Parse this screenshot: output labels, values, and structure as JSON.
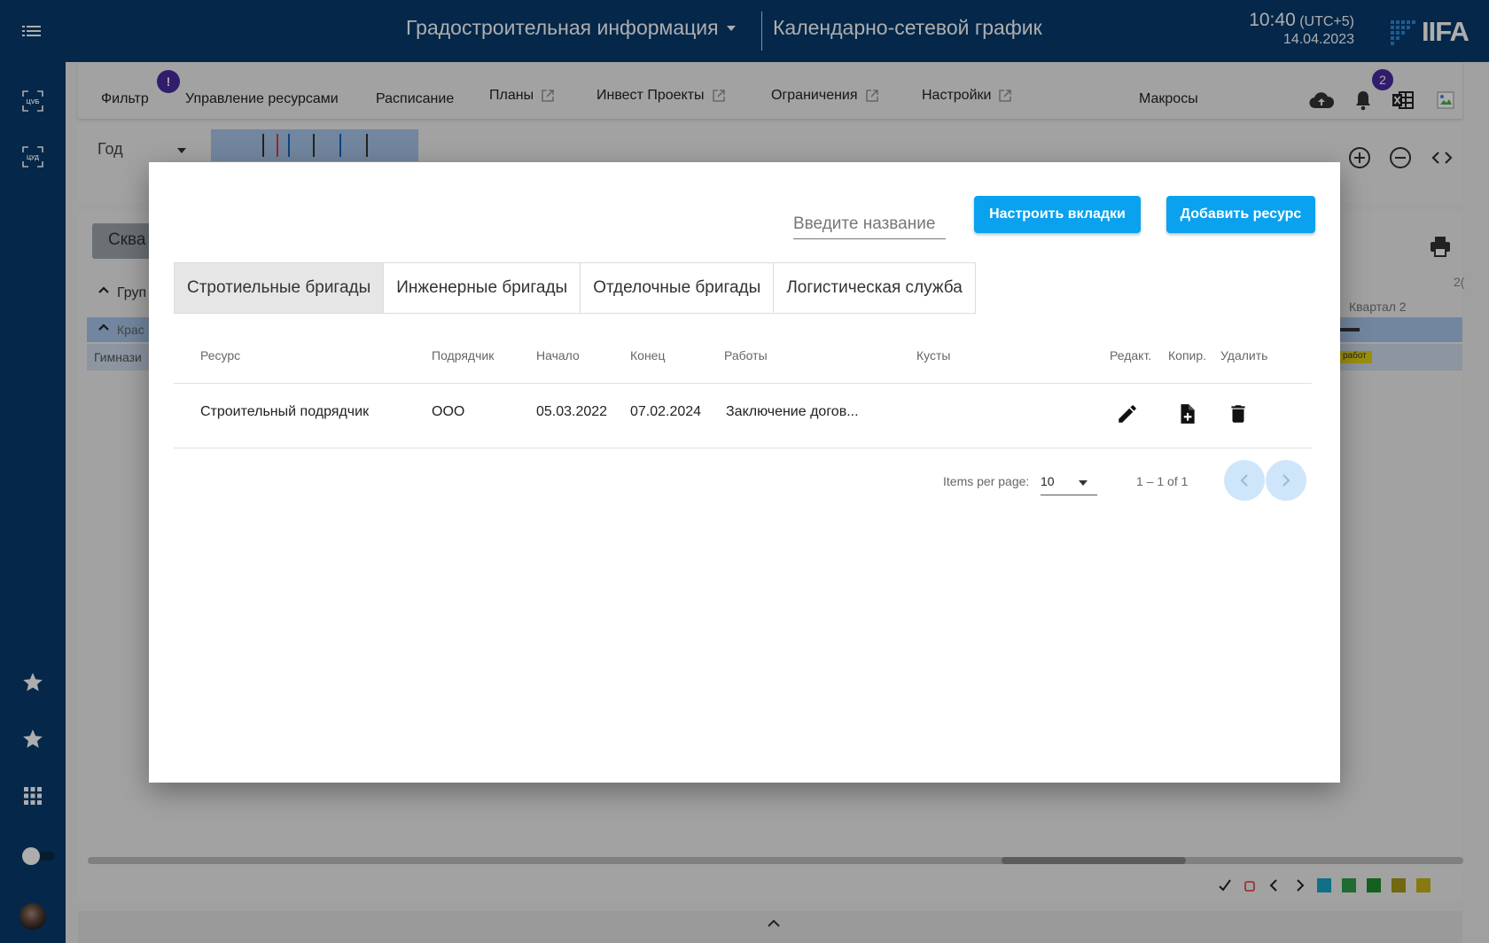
{
  "header": {
    "module_title": "Градостроительная информация",
    "page_title": "Календарно-сетевой график",
    "time": "10:40",
    "timezone": "(UTC+5)",
    "date": "14.04.2023",
    "logo_text": "IIFA"
  },
  "left_nav": {
    "items": [
      "menu-icon",
      "cvb-icon",
      "cud-icon",
      "star-icon",
      "star-icon",
      "grid-icon",
      "toggle",
      "avatar"
    ]
  },
  "toolbar": {
    "filter": "Фильтр",
    "filter_badge": "!",
    "resources": "Управление ресурсами",
    "schedule": "Расписание",
    "plans": "Планы",
    "invest": "Инвест Проекты",
    "limits": "Ограничения",
    "settings": "Настройки",
    "macros": "Макросы",
    "notif_count": "2"
  },
  "scale": {
    "label": "Год"
  },
  "background": {
    "grey_button": "Сква",
    "group_label": "Груп",
    "row1": "Крас",
    "row2": "Гимнази",
    "quarter": "Квартал 2",
    "year_partial": "2(",
    "works_chip": "работ"
  },
  "modal": {
    "search_placeholder": "Введите название",
    "configure_tabs": "Настроить вкладки",
    "add_resource": "Добавить ресурс",
    "tabs": [
      "Стротиельные бригады",
      "Инженерные бригады",
      "Отделочные бригады",
      "Логистическая служба"
    ],
    "active_tab": 0,
    "columns": {
      "resource": "Ресурс",
      "contractor": "Подрядчик",
      "start": "Начало",
      "end": "Конец",
      "works": "Работы",
      "bushes": "Кусты",
      "edit": "Редакт.",
      "copy": "Копир.",
      "delete": "Удалить"
    },
    "rows": [
      {
        "resource": "Строительный подрядчик",
        "contractor": "ООО",
        "start": "05.03.2022",
        "end": "07.02.2024",
        "works": "Заключение догов...",
        "bushes": ""
      }
    ],
    "pager": {
      "items_per_page_label": "Items per page:",
      "items_per_page": "10",
      "range": "1 – 1 of 1"
    }
  },
  "colors": {
    "header_bg": "#063a6e",
    "accent_blue": "#0aa2ef",
    "badge_purple": "#4a2a9f",
    "legend": [
      "#1aa6c4",
      "#2e9e4a",
      "#1c8f2c",
      "#a79a18",
      "#c8b41a"
    ]
  }
}
